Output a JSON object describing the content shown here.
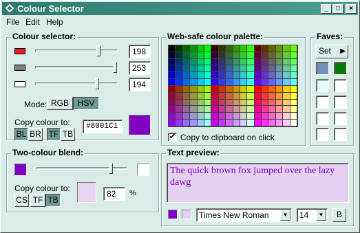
{
  "window": {
    "title": "Colour Selector"
  },
  "menu": [
    "File",
    "Edit",
    "Help"
  ],
  "colour_selector": {
    "title": "Colour selector:",
    "sliders": [
      {
        "swatch": "#e02020",
        "value": "198",
        "level": 0.78
      },
      {
        "swatch": "#808080",
        "value": "253",
        "level": 0.99
      },
      {
        "swatch": "#ffffff",
        "value": "194",
        "level": 0.76
      }
    ],
    "mode_label": "Mode:",
    "mode_options": [
      "RGB",
      "HSV"
    ],
    "mode_selected": "HSV",
    "copy_label": "Copy colour to:",
    "copy_buttons": [
      "BL",
      "BR",
      "TF",
      "TB"
    ],
    "hex_value": "#8001C1",
    "current_colour": "#8001c1"
  },
  "palette": {
    "title": "Web-safe colour palette:",
    "copy_checkbox_label": "Copy to clipboard on click",
    "copy_checked": true
  },
  "faves": {
    "title": "Faves:",
    "set_label": "Set",
    "swatches": [
      "#7090b8",
      "#087808",
      "#e0fcfc",
      "#ffffff",
      "#ffffff",
      "#ffffff",
      "#ffffff",
      "#ffffff",
      "#ffffff",
      "#ffffff"
    ]
  },
  "blend": {
    "title": "Two-colour blend:",
    "left_colour": "#8001c1",
    "right_colour": "#ffffff",
    "level": 0.83,
    "copy_label": "Copy colour to:",
    "copy_buttons": [
      "CS",
      "TF",
      "TB"
    ],
    "result_colour": "#e8d4f0",
    "percent_value": "82",
    "percent_sign": "%"
  },
  "text_preview": {
    "title": "Text preview:",
    "text": "The quick brown fox jumped over the lazy dawg",
    "foreground": "#8001c1",
    "background": "#e4d0f0",
    "font": "Times New Roman",
    "size": "14",
    "bold_label": "B"
  }
}
